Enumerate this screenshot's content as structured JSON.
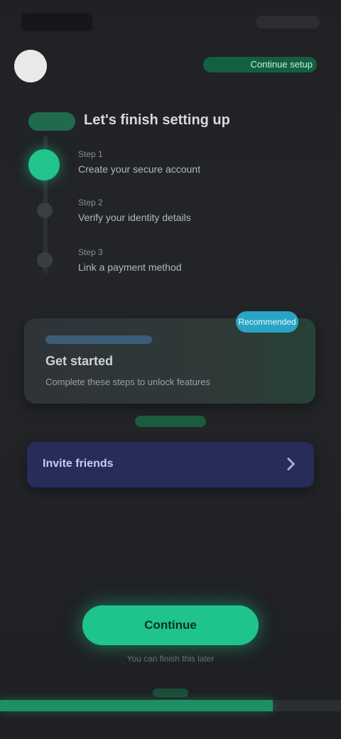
{
  "header": {
    "link": "Continue setup"
  },
  "title": "Let's finish setting up",
  "steps": [
    {
      "small": "Step 1",
      "line": "Create your secure account"
    },
    {
      "small": "Step 2",
      "line": "Verify your identity details"
    },
    {
      "small": "Step 3",
      "line": "Link a payment method"
    }
  ],
  "card": {
    "badge": "Recommended",
    "heading": "Get started",
    "description": "Complete these steps to unlock features"
  },
  "banner": {
    "text": "Invite friends"
  },
  "cta": {
    "label": "Continue",
    "note": "You can finish this later"
  },
  "progress": {
    "fraction": 0.8
  },
  "colors": {
    "accent": "#1fc48b",
    "banner": "#272c5a",
    "badge": "#2aa4c4"
  }
}
